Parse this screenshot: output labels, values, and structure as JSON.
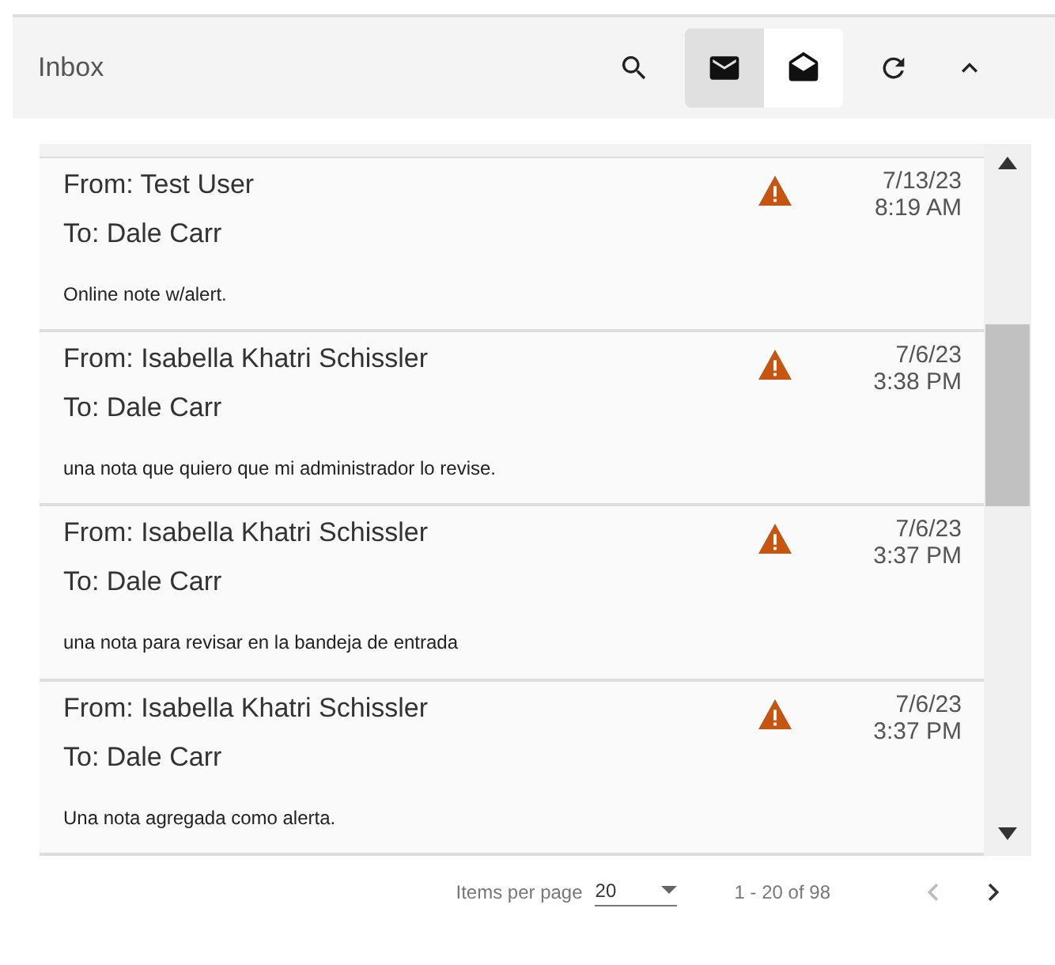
{
  "header": {
    "title": "Inbox",
    "view_toggle": [
      {
        "kind": "closed",
        "selected": true
      },
      {
        "kind": "open",
        "selected": false
      }
    ]
  },
  "messages": [
    {
      "from": "From: Test User",
      "to": "To: Dale Carr",
      "date": "7/13/23",
      "time": "8:19 AM",
      "body": "Online note w/alert.",
      "alert": true
    },
    {
      "from": "From: Isabella Khatri Schissler",
      "to": "To: Dale Carr",
      "date": "7/6/23",
      "time": "3:38 PM",
      "body": "una nota que quiero que mi administrador lo revise.",
      "alert": true
    },
    {
      "from": "From: Isabella Khatri Schissler",
      "to": "To: Dale Carr",
      "date": "7/6/23",
      "time": "3:37 PM",
      "body": "una nota para revisar en la bandeja de entrada",
      "alert": true
    },
    {
      "from": "From: Isabella Khatri Schissler",
      "to": "To: Dale Carr",
      "date": "7/6/23",
      "time": "3:37 PM",
      "body": "Una nota agregada como alerta.",
      "alert": true
    }
  ],
  "paginator": {
    "items_per_page_label": "Items per page",
    "page_size": "20",
    "range": "1 - 20 of 98"
  }
}
